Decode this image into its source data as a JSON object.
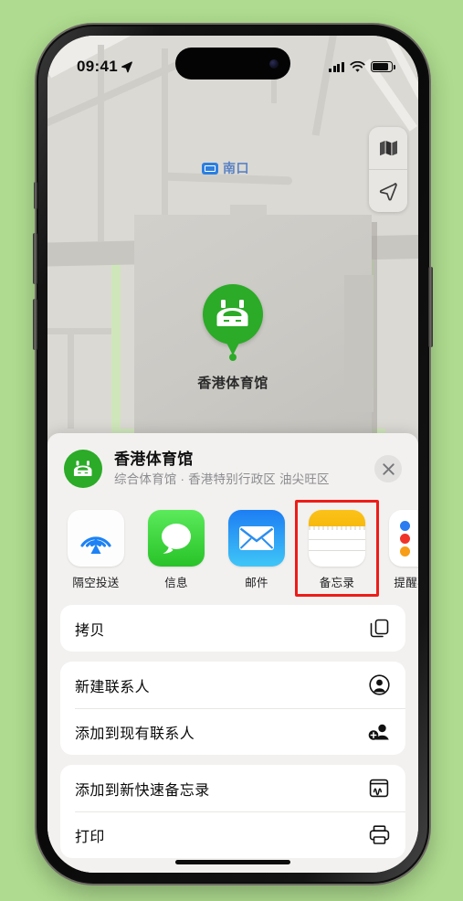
{
  "statusbar": {
    "time": "09:41",
    "location_icon": "location-arrow-icon",
    "signal_icon": "cellular-bars-icon",
    "wifi_icon": "wifi-icon",
    "battery_icon": "battery-full-icon"
  },
  "map": {
    "transit_label": "南口",
    "transit_badge_icon": "mtr-entrance-icon",
    "pin_label": "香港体育馆",
    "pin_icon": "stadium-icon",
    "pin_color": "#2bab27",
    "controls": [
      {
        "name": "map-style-button",
        "icon": "folded-map-icon"
      },
      {
        "name": "locate-me-button",
        "icon": "location-arrow-icon"
      }
    ]
  },
  "sheet": {
    "title": "香港体育馆",
    "subtitle": "综合体育馆 · 香港特别行政区 油尖旺区",
    "avatar_icon": "stadium-icon",
    "close_icon": "close-icon",
    "apps": [
      {
        "label": "隔空投送",
        "icon": "airdrop-icon",
        "highlighted": false
      },
      {
        "label": "信息",
        "icon": "messages-icon",
        "highlighted": false
      },
      {
        "label": "邮件",
        "icon": "mail-icon",
        "highlighted": false
      },
      {
        "label": "备忘录",
        "icon": "notes-icon",
        "highlighted": true
      },
      {
        "label": "提醒事项",
        "icon": "reminders-icon",
        "highlighted": false
      }
    ],
    "highlight_color": "#ee1c18",
    "action_groups": [
      {
        "items": [
          {
            "label": "拷贝",
            "icon": "copy-icon"
          }
        ]
      },
      {
        "items": [
          {
            "label": "新建联系人",
            "icon": "person-circle-icon"
          },
          {
            "label": "添加到现有联系人",
            "icon": "person-add-icon"
          }
        ]
      },
      {
        "items": [
          {
            "label": "添加到新快速备忘录",
            "icon": "quick-note-icon"
          },
          {
            "label": "打印",
            "icon": "printer-icon"
          }
        ]
      }
    ]
  }
}
